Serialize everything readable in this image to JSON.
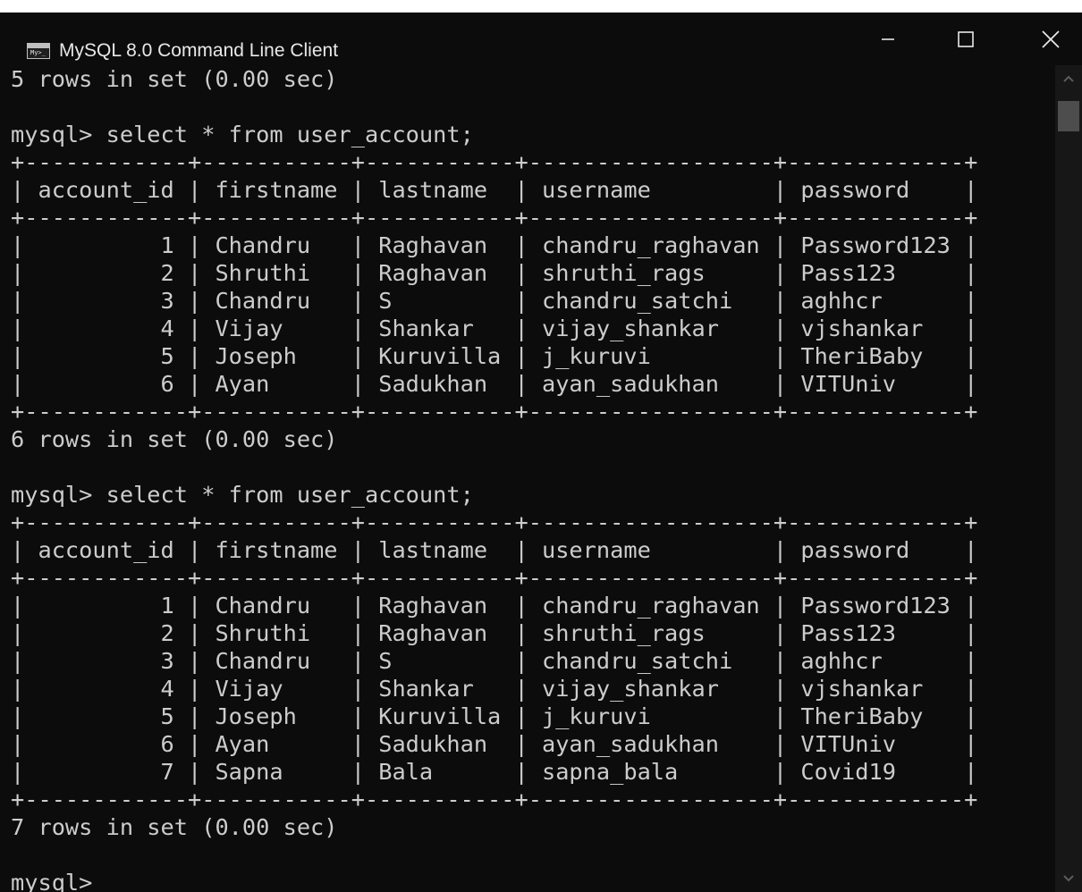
{
  "window": {
    "title": "MySQL 8.0 Command Line Client",
    "icon_name": "mysql-console-icon",
    "icon_text": "My>_",
    "controls": {
      "minimize": "minimize-icon",
      "maximize": "maximize-icon",
      "close": "close-icon"
    }
  },
  "console": {
    "lines": [
      "5 rows in set (0.00 sec)",
      "",
      "mysql> select * from user_account;",
      "+------------+-----------+-----------+------------------+-------------+",
      "| account_id | firstname | lastname  | username         | password    |",
      "+------------+-----------+-----------+------------------+-------------+",
      "|          1 | Chandru   | Raghavan  | chandru_raghavan | Password123 |",
      "|          2 | Shruthi   | Raghavan  | shruthi_rags     | Pass123     |",
      "|          3 | Chandru   | S         | chandru_satchi   | aghhcr      |",
      "|          4 | Vijay     | Shankar   | vijay_shankar    | vjshankar   |",
      "|          5 | Joseph    | Kuruvilla | j_kuruvi         | TheriBaby   |",
      "|          6 | Ayan      | Sadukhan  | ayan_sadukhan    | VITUniv     |",
      "+------------+-----------+-----------+------------------+-------------+",
      "6 rows in set (0.00 sec)",
      "",
      "mysql> select * from user_account;",
      "+------------+-----------+-----------+------------------+-------------+",
      "| account_id | firstname | lastname  | username         | password    |",
      "+------------+-----------+-----------+------------------+-------------+",
      "|          1 | Chandru   | Raghavan  | chandru_raghavan | Password123 |",
      "|          2 | Shruthi   | Raghavan  | shruthi_rags     | Pass123     |",
      "|          3 | Chandru   | S         | chandru_satchi   | aghhcr      |",
      "|          4 | Vijay     | Shankar   | vijay_shankar    | vjshankar   |",
      "|          5 | Joseph    | Kuruvilla | j_kuruvi         | TheriBaby   |",
      "|          6 | Ayan      | Sadukhan  | ayan_sadukhan    | VITUniv     |",
      "|          7 | Sapna     | Bala      | sapna_bala       | Covid19     |",
      "+------------+-----------+-----------+------------------+-------------+",
      "7 rows in set (0.00 sec)",
      "",
      "mysql>"
    ]
  },
  "scrollbar": {
    "up": "scroll-up-arrow-icon",
    "down": "scroll-down-arrow-icon"
  },
  "colors": {
    "background": "#0c0c0c",
    "text": "#cccccc",
    "title_text": "#e8e8e8"
  }
}
